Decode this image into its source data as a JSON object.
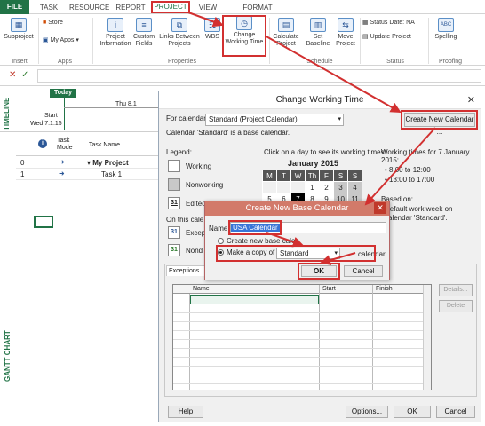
{
  "ribbon": {
    "tabs": [
      "FILE",
      "TASK",
      "RESOURCE",
      "REPORT",
      "PROJECT",
      "VIEW",
      "FORMAT"
    ],
    "active_tab": "PROJECT",
    "buttons": {
      "subproject": "Subproject",
      "store": "Store",
      "my_apps": "My Apps",
      "project_information": "Project Information",
      "custom_fields": "Custom Fields",
      "links_between_projects": "Links Between Projects",
      "wbs": "WBS",
      "change_working_time": "Change Working Time",
      "calculate_project": "Calculate Project",
      "set_baseline": "Set Baseline",
      "move_project": "Move Project",
      "status_date_label": "Status Date:",
      "status_date_value": "NA",
      "update_project": "Update Project",
      "spelling": "Spelling"
    },
    "groups": [
      "Insert",
      "Apps",
      "Properties",
      "Schedule",
      "Status",
      "Proofing"
    ]
  },
  "timeline": {
    "label": "TIMELINE",
    "today": "Today",
    "date_marker": "Thu 8.1",
    "start_label": "Start",
    "start_date": "Wed 7.1.15"
  },
  "grid": {
    "headers": [
      "Task Mode",
      "Task Name"
    ],
    "rows": [
      {
        "id": "0",
        "name": "My Project"
      },
      {
        "id": "1",
        "name": "Task 1"
      }
    ],
    "side_label": "GANTT CHART"
  },
  "dialog": {
    "title": "Change Working Time",
    "for_calendar_label": "For calendar:",
    "calendar_value": "Standard (Project Calendar)",
    "base_note": "Calendar 'Standard' is a base calendar.",
    "create_new_calendar": "Create New Calendar ...",
    "legend_label": "Legend:",
    "legend_items": [
      "Working",
      "Nonworking",
      "Edited",
      "Excep",
      "Nond"
    ],
    "on_this_cal": "On this cale",
    "click_day": "Click on a day to see its working times:",
    "month": "January 2015",
    "weekdays": [
      "M",
      "T",
      "W",
      "Th",
      "F",
      "S",
      "S"
    ],
    "weeks": [
      [
        "",
        "",
        "",
        "1",
        "2",
        "3",
        "4"
      ],
      [
        "5",
        "6",
        "7",
        "8",
        "9",
        "10",
        "11"
      ]
    ],
    "working_times_title": "Working times for 7 January 2015:",
    "working_times": [
      "8:00 to 12:00",
      "13:00 to 17:00"
    ],
    "based_on": "Based on:",
    "based_on_detail": "Default work week on calendar 'Standard'.",
    "exceptions_label": "Exceptions",
    "table_headers": [
      "Name",
      "Start",
      "Finish"
    ],
    "details": "Details...",
    "delete": "Delete",
    "help": "Help",
    "options": "Options...",
    "ok": "OK",
    "cancel": "Cancel"
  },
  "subdialog": {
    "title": "Create New Base Calendar",
    "name_label": "Name:",
    "name_value": "USA Calendar",
    "option_new": "Create new base calen",
    "option_copy": "Make a copy of",
    "copy_source": "Standard",
    "copy_suffix": "calendar",
    "ok": "OK",
    "cancel": "Cancel"
  },
  "colors": {
    "accent": "#217346",
    "highlight": "#d23030",
    "selected_day": "#000000",
    "nonworking": "#c8c8c8"
  }
}
